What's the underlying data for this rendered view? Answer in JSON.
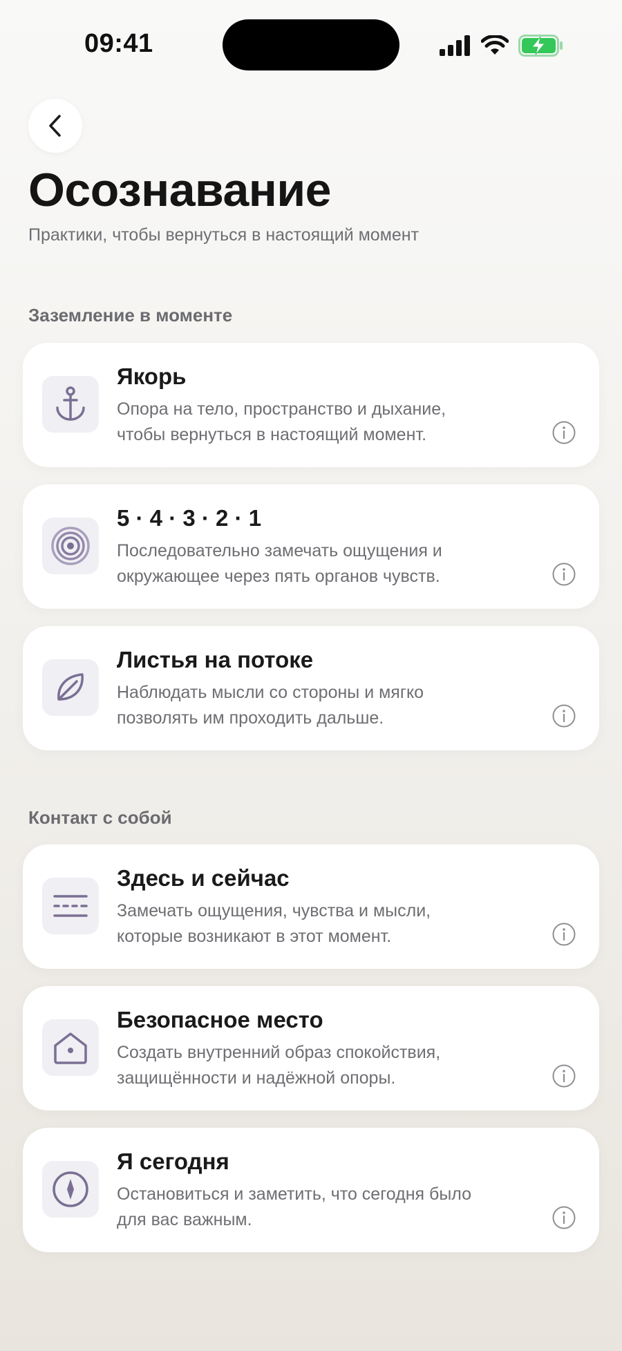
{
  "status_bar": {
    "time": "09:41",
    "signal_icon": "cellular-signal-icon",
    "wifi_icon": "wifi-icon",
    "battery_icon": "battery-charging-icon",
    "battery_color": "#34c759"
  },
  "header": {
    "back_icon": "chevron-left-icon",
    "title": "Осознавание",
    "subtitle": "Практики, чтобы вернуться в настоящий момент"
  },
  "colors": {
    "accent": "#7a6f93",
    "icon_tile": "#f0eff3",
    "text_primary": "#1a1a1a",
    "text_secondary": "#6e6e73"
  },
  "sections": [
    {
      "title": "Заземление в моменте",
      "items": [
        {
          "icon": "anchor-icon",
          "title": "Якорь",
          "desc_line1": "Опора на тело, пространство и дыхание,",
          "desc_line2": "чтобы вернуться в настоящий момент."
        },
        {
          "icon": "concentric-circles-icon",
          "title": "5 · 4 · 3 · 2 · 1",
          "desc_line1": "Последовательно замечать ощущения и",
          "desc_line2": "окружающее через пять органов чувств."
        },
        {
          "icon": "leaf-icon",
          "title": "Листья на потоке",
          "desc_line1": "Наблюдать мысли со стороны и мягко",
          "desc_line2": "позволять им проходить дальше."
        }
      ]
    },
    {
      "title": "Контакт с собой",
      "items": [
        {
          "icon": "lines-icon",
          "title": "Здесь и сейчас",
          "desc_line1": "Замечать ощущения, чувства и мысли,",
          "desc_line2": "которые возникают в этот момент."
        },
        {
          "icon": "home-icon",
          "title": "Безопасное место",
          "desc_line1": "Создать внутренний образ спокойствия,",
          "desc_line2": "защищённости и надёжной опоры."
        },
        {
          "icon": "compass-icon",
          "title": "Я сегодня",
          "desc_line1": "Остановиться и заметить, что сегодня было",
          "desc_line2": "для вас важным."
        }
      ]
    }
  ]
}
